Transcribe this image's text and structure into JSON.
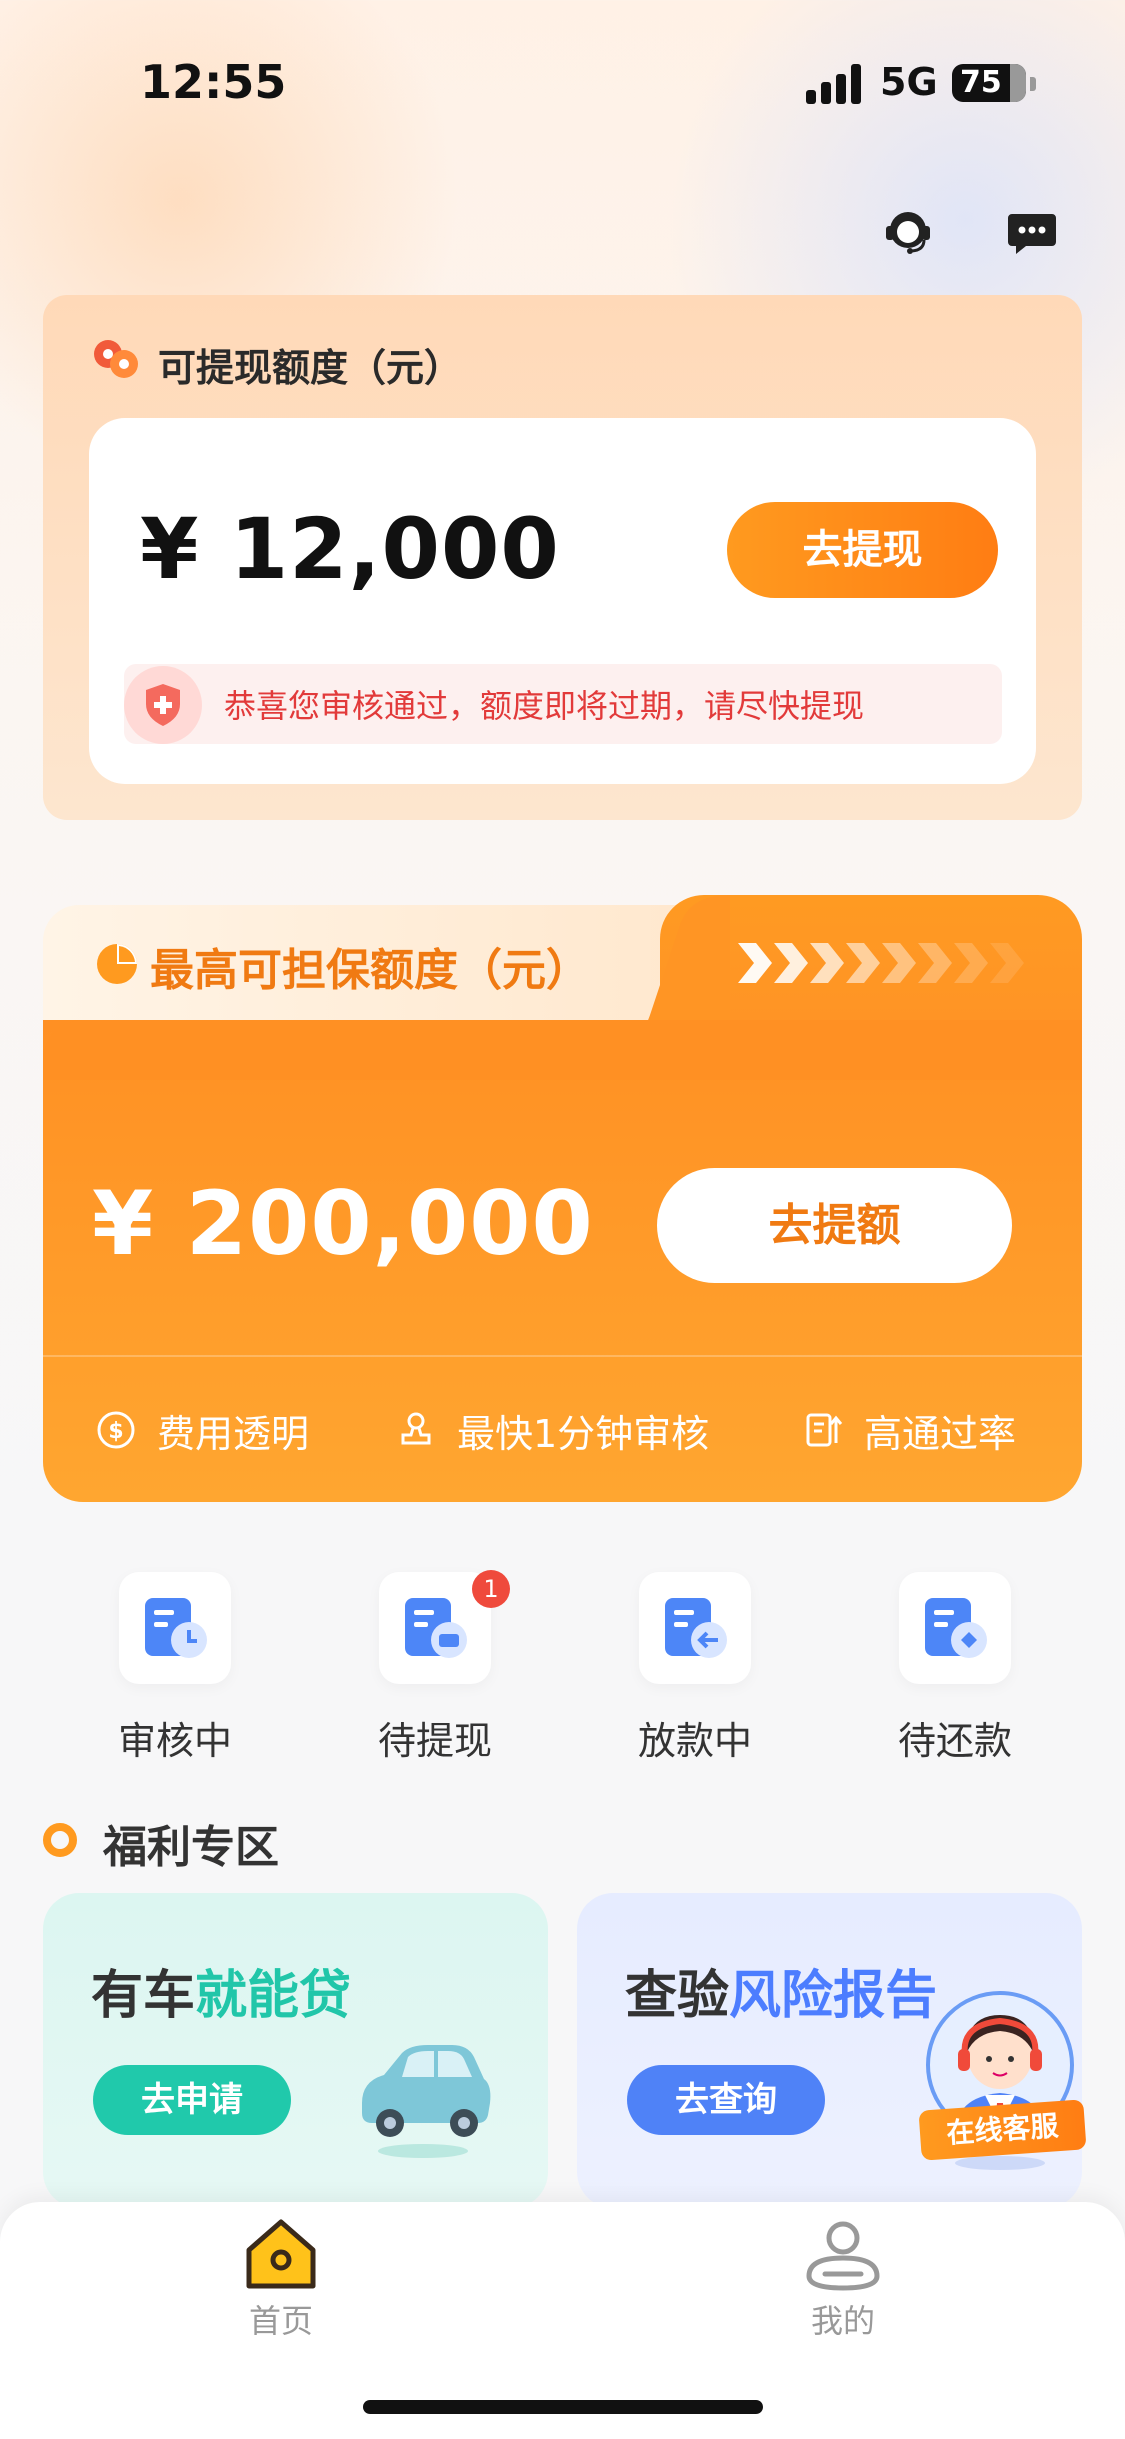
{
  "status_bar": {
    "time": "12:55",
    "network": "5G",
    "battery": "75"
  },
  "header": {
    "icons": [
      "customer-service-icon",
      "message-icon"
    ]
  },
  "withdraw_card": {
    "title": "可提现额度（元）",
    "amount": "¥ 12,000",
    "button_label": "去提现",
    "notice": "恭喜您审核通过，额度即将过期，请尽快提现"
  },
  "guarantee_card": {
    "title": "最高可担保额度（元）",
    "amount": "¥ 200,000",
    "button_label": "去提额",
    "features": [
      "费用透明",
      "最快1分钟审核",
      "高通过率"
    ]
  },
  "order_status": {
    "items": [
      {
        "label": "审核中",
        "badge": ""
      },
      {
        "label": "待提现",
        "badge": "1"
      },
      {
        "label": "放款中",
        "badge": ""
      },
      {
        "label": "待还款",
        "badge": ""
      }
    ]
  },
  "welfare": {
    "title": "福利专区",
    "promos": [
      {
        "title_prefix": "有车",
        "title_highlight": "就能贷",
        "button_label": "去申请"
      },
      {
        "title_prefix": "查验",
        "title_highlight": "风险报告",
        "button_label": "去查询"
      }
    ]
  },
  "online_service": {
    "label": "在线客服"
  },
  "tab_bar": {
    "tabs": [
      {
        "label": "首页",
        "active": true
      },
      {
        "label": "我的",
        "active": false
      }
    ]
  },
  "colors": {
    "accent_orange": "#ff9023",
    "teal": "#20c9ab",
    "blue": "#4f82f7",
    "notice_red": "#e23a3a"
  }
}
